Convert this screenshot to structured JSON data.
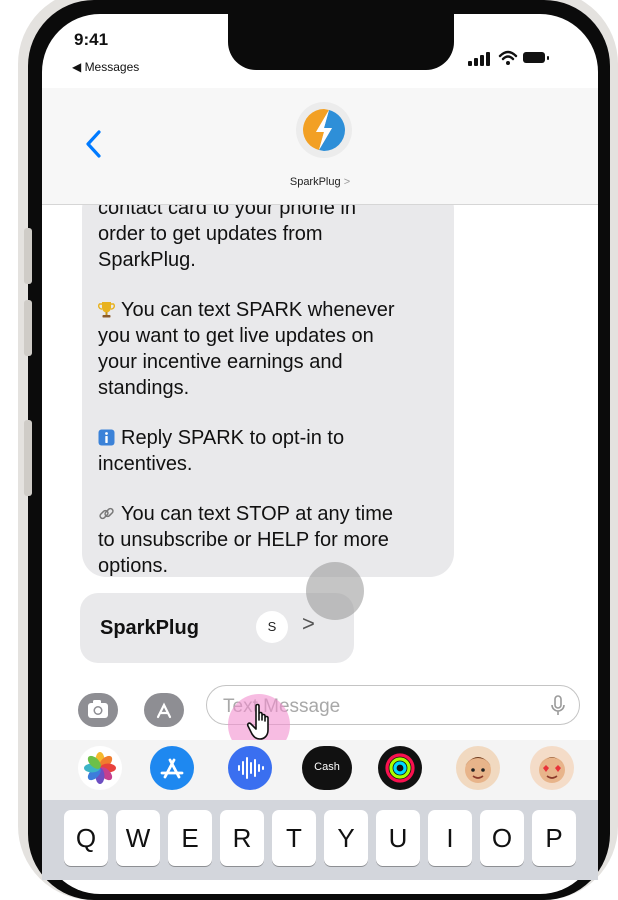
{
  "status_bar": {
    "time": "9:41",
    "back_app": "◀ Messages"
  },
  "header": {
    "contact_name": "SparkPlug",
    "contact_chevron": ">",
    "brand_colors": {
      "orange": "#f2a024",
      "blue": "#2e8fd8"
    }
  },
  "message": {
    "lines": [
      "contact card to your phone in",
      "order to get updates from",
      "SparkPlug.",
      "You can text SPARK whenever",
      "you want to get live updates on",
      "your incentive earnings and",
      "standings.",
      "Reply SPARK to opt-in to",
      "incentives.",
      "You can text STOP at any time",
      "to unsubscribe or HELP for more",
      "options."
    ],
    "icons": [
      "trophy-icon",
      "info-icon",
      "link-icon"
    ]
  },
  "contact_card": {
    "name": "SparkPlug",
    "initial": "S",
    "chevron": ">"
  },
  "input": {
    "placeholder": "Text Message"
  },
  "apps": [
    "photos-icon",
    "app-store-icon",
    "audio-icon",
    "apple-cash-icon",
    "fitness-icon",
    "memoji-icon",
    "memoji-heart-icon"
  ],
  "apple_cash_label": "Cash",
  "keyboard_row": [
    "Q",
    "W",
    "E",
    "R",
    "T",
    "Y",
    "U",
    "I",
    "O",
    "P"
  ],
  "colors": {
    "accent": "#007aff",
    "bubble": "#e9e9eb",
    "touch_highlight": "#f28fce"
  }
}
